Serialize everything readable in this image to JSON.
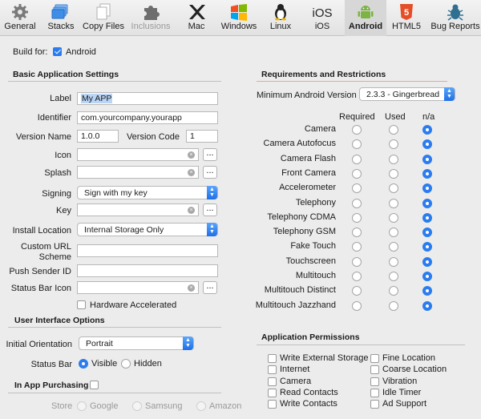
{
  "toolbar": {
    "items": [
      {
        "label": "General",
        "icon": "gear-icon"
      },
      {
        "label": "Stacks",
        "icon": "stacks-icon"
      },
      {
        "label": "Copy Files",
        "icon": "copy-files-icon"
      },
      {
        "label": "Inclusions",
        "icon": "puzzle-icon"
      },
      {
        "label": "Mac",
        "icon": "mac-x-icon"
      },
      {
        "label": "Windows",
        "icon": "windows-icon"
      },
      {
        "label": "Linux",
        "icon": "linux-icon"
      },
      {
        "label": "iOS",
        "icon": "ios-icon"
      },
      {
        "label": "Android",
        "icon": "android-icon"
      },
      {
        "label": "HTML5",
        "icon": "html5-icon"
      },
      {
        "label": "Bug Reports",
        "icon": "bug-icon"
      }
    ]
  },
  "build_for": {
    "label": "Build for:",
    "value": "Android",
    "checked": true
  },
  "basic": {
    "title": "Basic Application Settings",
    "label_label": "Label",
    "label_value": "My APP",
    "identifier_label": "Identifier",
    "identifier_value": "com.yourcompany.yourapp",
    "version_name_label": "Version Name",
    "version_name_value": "1.0.0",
    "version_code_label": "Version Code",
    "version_code_value": "1",
    "icon_label": "Icon",
    "splash_label": "Splash",
    "signing_label": "Signing",
    "signing_value": "Sign with my key",
    "key_label": "Key",
    "install_label": "Install Location",
    "install_value": "Internal Storage Only",
    "custom_url_label_1": "Custom URL",
    "custom_url_label_2": "Scheme",
    "push_label": "Push Sender ID",
    "statusbar_icon_label": "Status Bar Icon",
    "hw_accel_label": "Hardware Accelerated",
    "browse": "..."
  },
  "ui_options": {
    "title": "User Interface Options",
    "orientation_label": "Initial Orientation",
    "orientation_value": "Portrait",
    "status_bar_label": "Status Bar",
    "visible_label": "Visible",
    "hidden_label": "Hidden"
  },
  "iap": {
    "title": "In App Purchasing",
    "store_label": "Store",
    "google": "Google",
    "samsung": "Samsung",
    "amazon": "Amazon"
  },
  "requirements": {
    "title": "Requirements and Restrictions",
    "min_version_label": "Minimum Android Version",
    "min_version_value": "2.3.3 - Gingerbread",
    "headers": [
      "Required",
      "Used",
      "n/a"
    ],
    "rows": [
      {
        "name": "Camera",
        "selected": "n/a"
      },
      {
        "name": "Camera Autofocus",
        "selected": "n/a"
      },
      {
        "name": "Camera Flash",
        "selected": "n/a"
      },
      {
        "name": "Front Camera",
        "selected": "n/a"
      },
      {
        "name": "Accelerometer",
        "selected": "n/a"
      },
      {
        "name": "Telephony",
        "selected": "n/a"
      },
      {
        "name": "Telephony CDMA",
        "selected": "n/a"
      },
      {
        "name": "Telephony GSM",
        "selected": "n/a"
      },
      {
        "name": "Fake Touch",
        "selected": "n/a"
      },
      {
        "name": "Touchscreen",
        "selected": "n/a"
      },
      {
        "name": "Multitouch",
        "selected": "n/a"
      },
      {
        "name": "Multitouch Distinct",
        "selected": "n/a"
      },
      {
        "name": "Multitouch Jazzhand",
        "selected": "n/a"
      }
    ]
  },
  "permissions": {
    "title": "Application Permissions",
    "left": [
      "Write External Storage",
      "Internet",
      "Camera",
      "Read Contacts",
      "Write Contacts"
    ],
    "right": [
      "Fine Location",
      "Coarse Location",
      "Vibration",
      "Idle Timer",
      "Ad Support"
    ]
  },
  "colors": {
    "accent": "#2a7cf0",
    "selection": "#b9d4f5"
  }
}
